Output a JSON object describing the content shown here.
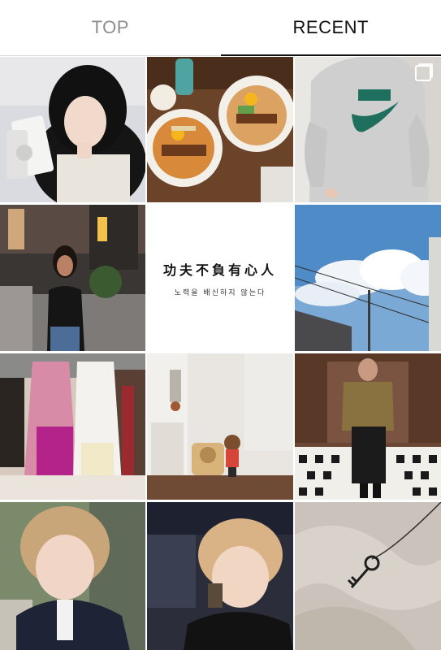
{
  "tabs": {
    "top_label": "TOP",
    "recent_label": "RECENT"
  },
  "posts": {
    "quote_main": "功夫不負有心人",
    "quote_sub": "노력을 배신하지 않는다"
  },
  "colors": {
    "active_tab": "#111111",
    "inactive_tab": "#8e8e8e"
  },
  "icons": {
    "multi_photo": "multi-photo-icon"
  }
}
